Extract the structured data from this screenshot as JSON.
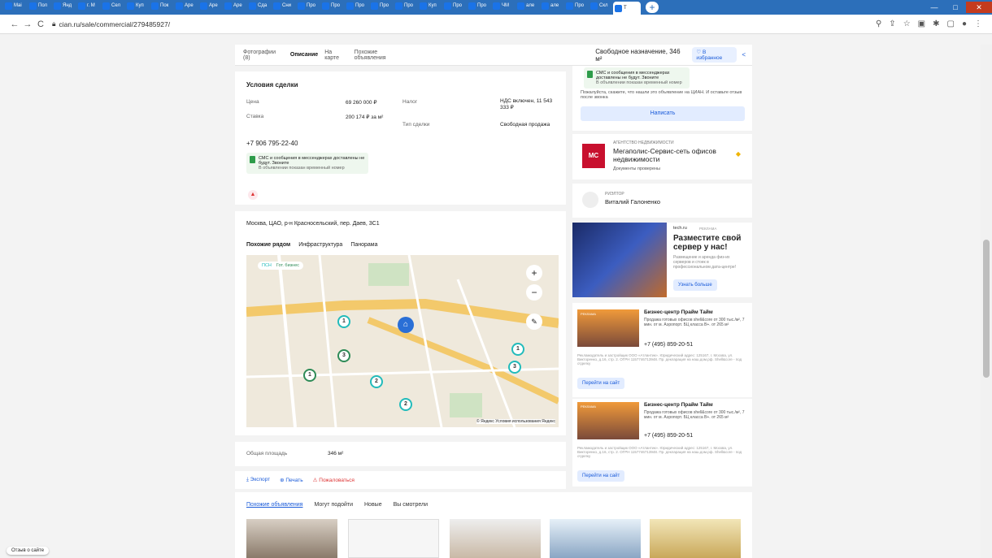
{
  "browser": {
    "tabs": [
      "Mai",
      "Пол",
      "Янд",
      "г. М",
      "Сел",
      "Куп",
      "Пок",
      "Аре",
      "Аре",
      "Аре",
      "Сда",
      "Сни",
      "Про",
      "Про",
      "Про",
      "Про",
      "Про",
      "Куп",
      "Про",
      "Про",
      "ЧМ",
      "але",
      "але",
      "Про",
      "Скл",
      "Т"
    ],
    "url": "cian.ru/sale/commercial/279485927/",
    "back": "←",
    "forward": "→",
    "reload": "C"
  },
  "subnav": {
    "tabs": [
      "Фотографии (8)",
      "Описание",
      "На карте",
      "Похожие объявления"
    ],
    "title": "Свободное назначение, 346 м²",
    "favorites": "♡ В избранное"
  },
  "deal": {
    "heading": "Условия сделки",
    "price_label": "Цена",
    "price": "69 260 000 ₽",
    "rate_label": "Ставка",
    "rate": "200 174 ₽ за м²",
    "tax_label": "Налог",
    "tax": "НДС включен, 11 543 333 ₽",
    "type_label": "Тип сделки",
    "type": "Свободная продажа",
    "phone": "+7 906 795-22-40",
    "sms_title": "СМС и сообщения в мессенджерах доставлены не будут. Звоните",
    "sms_sub": "В объявлении показан временный номер"
  },
  "map": {
    "address": "Москва, ЦАО, р-н Красносельский, пер. Даев, 3С1",
    "tabs": [
      "Похожие рядом",
      "Инфраструктура",
      "Панорама"
    ],
    "legend": [
      "ПСН",
      "Гот. бизнес"
    ],
    "copyright": "© Яндекс Условия использования Яндекс",
    "markers": [
      "1",
      "3",
      "1",
      "2",
      "2",
      "1",
      "3"
    ]
  },
  "area": {
    "label": "Общая площадь",
    "value": "346 м²"
  },
  "actions": [
    "⤓ Экспорт",
    "⊕ Печать",
    "⚠ Пожаловаться"
  ],
  "sidebar": {
    "sms_title": "СМС и сообщения в мессенджерах доставлены не будут. Звоните",
    "sms_sub": "В объявлении показан временный номер",
    "notice": "Пожалуйста, скажите, что нашли это объявление на ЦИАН. И оставьте отзыв после звонка",
    "write_btn": "Написать",
    "agency_label": "АГЕНТСТВО НЕДВИЖИМОСТИ",
    "agency_name": "Мегаполис-Сервис-сеть офисов недвижимости",
    "agency_docs": "Документы проверены",
    "realtor_label": "РИЭЛТОР",
    "realtor_name": "Виталий Галоненко"
  },
  "ad": {
    "source": "tech.ru",
    "badge": "РЕКЛАМА",
    "title": "Разместите свой сервер у нас!",
    "text": "Размещение и аренда физ-их серверов и стоек в профессиональном дата-центре!",
    "btn": "Узнать больше"
  },
  "promos": [
    {
      "badge": "РЕКЛАМА",
      "title": "Бизнес-центр Прайм Тайм",
      "text": "Продажа готовых офисов shell&core от 300 тыс./м², 7 мин. от м. Аэропорт. БЦ класса В+. от 265 м²",
      "phone": "+7 (495) 859-20-51",
      "legal": "Рекламодатель и застройщик ООО «Атлантик». Юридический адрес: 125167, г. Москва, ул. Викторенко, д.16, стр. 2. ОГРН 1157746713948. Пр. декларация на наш.дом.рф. Shell&core - под отделку",
      "btn": "Перейти на сайт"
    },
    {
      "badge": "РЕКЛАМА",
      "title": "Бизнес-центр Прайм Тайм",
      "text": "Продажа готовых офисов shell&core от 300 тыс./м², 7 мин. от м. Аэропорт. БЦ класса В+. от 265 м²",
      "phone": "+7 (495) 859-20-51",
      "legal": "Рекламодатель и застройщик ООО «Атлантик». Юридический адрес: 125167, г. Москва, ул. Викторенко, д.16, стр. 2. ОГРН 1157746713948. Пр. декларация на наш.дом.рф. Shell&core - под отделку",
      "btn": "Перейти на сайт"
    }
  ],
  "feed": {
    "tabs": [
      "Похожие объявления",
      "Могут подойти",
      "Новые",
      "Вы смотрели"
    ]
  },
  "feedback": "Отзыв о сайте"
}
